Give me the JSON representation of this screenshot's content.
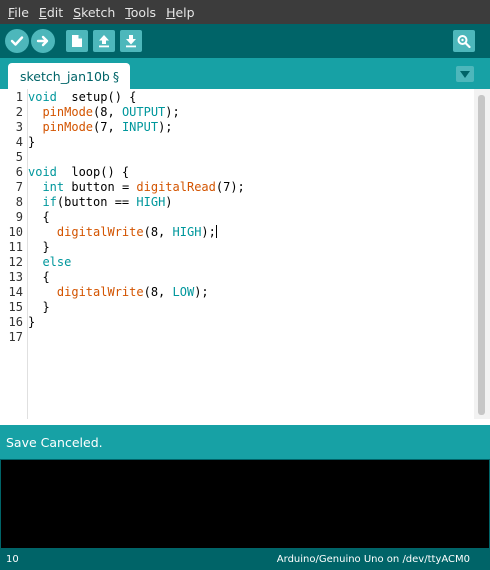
{
  "menu": [
    {
      "ul": "F",
      "rest": "ile"
    },
    {
      "ul": "E",
      "rest": "dit"
    },
    {
      "ul": "S",
      "rest": "ketch"
    },
    {
      "ul": "T",
      "rest": "ools"
    },
    {
      "ul": "H",
      "rest": "elp"
    }
  ],
  "toolbar": {
    "verify_icon": "check-icon",
    "upload_icon": "arrow-right-icon",
    "new_icon": "document-icon",
    "open_icon": "arrow-up-icon",
    "save_icon": "arrow-down-icon",
    "serial_monitor_icon": "magnifier-icon"
  },
  "tab": {
    "label": "sketch_jan10b",
    "modified": "§"
  },
  "code_lines": [
    [
      [
        "kw",
        "void"
      ],
      [
        "",
        "  setup() {"
      ]
    ],
    [
      [
        "",
        "  "
      ],
      [
        "fn",
        "pinMode"
      ],
      [
        "",
        "(8, "
      ],
      [
        "ct",
        "OUTPUT"
      ],
      [
        "",
        ");"
      ]
    ],
    [
      [
        "",
        "  "
      ],
      [
        "fn",
        "pinMode"
      ],
      [
        "",
        "(7, "
      ],
      [
        "ct",
        "INPUT"
      ],
      [
        "",
        ");"
      ]
    ],
    [
      [
        "",
        "}"
      ]
    ],
    [
      [
        "",
        ""
      ]
    ],
    [
      [
        "kw",
        "void"
      ],
      [
        "",
        "  loop() {"
      ]
    ],
    [
      [
        "",
        "  "
      ],
      [
        "kw",
        "int"
      ],
      [
        "",
        " button = "
      ],
      [
        "fn",
        "digitalRead"
      ],
      [
        "",
        "(7);"
      ]
    ],
    [
      [
        "",
        "  "
      ],
      [
        "kw",
        "if"
      ],
      [
        "",
        "(button == "
      ],
      [
        "ct",
        "HIGH"
      ],
      [
        "",
        ")"
      ]
    ],
    [
      [
        "",
        "  {"
      ]
    ],
    [
      [
        "",
        "    "
      ],
      [
        "fn",
        "digitalWrite"
      ],
      [
        "",
        "(8, "
      ],
      [
        "ct",
        "HIGH"
      ],
      [
        "",
        ");"
      ]
    ],
    [
      [
        "",
        "  }"
      ]
    ],
    [
      [
        "",
        "  "
      ],
      [
        "kw",
        "else"
      ]
    ],
    [
      [
        "",
        "  {"
      ]
    ],
    [
      [
        "",
        "    "
      ],
      [
        "fn",
        "digitalWrite"
      ],
      [
        "",
        "(8, "
      ],
      [
        "ct",
        "LOW"
      ],
      [
        "",
        ");"
      ]
    ],
    [
      [
        "",
        "  }"
      ]
    ],
    [
      [
        "",
        "}"
      ]
    ],
    [
      [
        "",
        ""
      ]
    ]
  ],
  "status_message": "Save Canceled.",
  "footer": {
    "line_number": "10",
    "board": "Arduino/Genuino Uno on /dev/ttyACM0"
  },
  "colors": {
    "toolbar": "#006468",
    "accent": "#17a1a5",
    "button": "#4db7bb",
    "keyword": "#00979c",
    "function": "#d35400"
  }
}
